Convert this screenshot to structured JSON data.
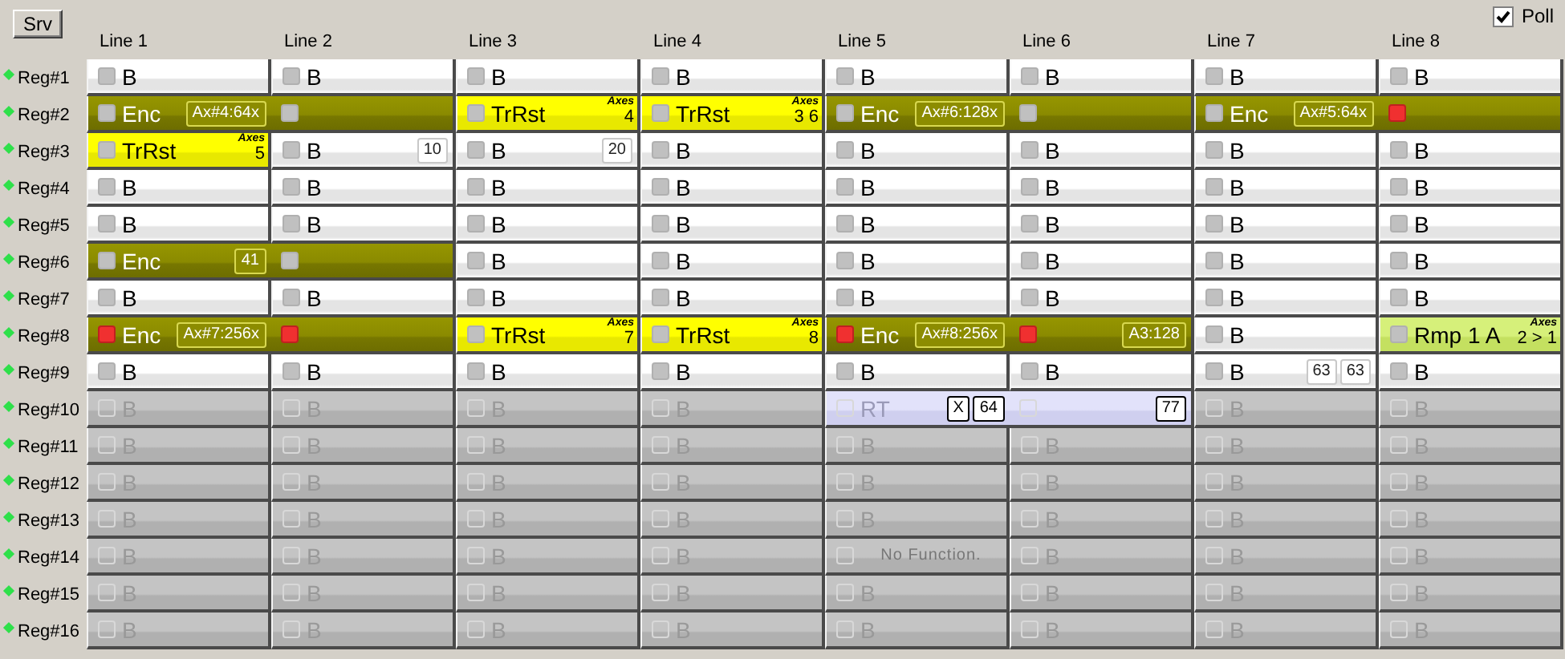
{
  "server_button": "Srv",
  "poll": {
    "label": "Poll",
    "checked": true
  },
  "lines": [
    "Line 1",
    "Line 2",
    "Line 3",
    "Line 4",
    "Line 5",
    "Line 6",
    "Line 7",
    "Line 8"
  ],
  "rows": [
    {
      "label": "Reg#1",
      "disabled": false,
      "cells": [
        {
          "kind": "b",
          "segments": [
            {
              "led_on": false,
              "label": "B"
            }
          ]
        },
        {
          "kind": "b",
          "segments": [
            {
              "led_on": false,
              "label": "B"
            }
          ]
        },
        {
          "kind": "b",
          "segments": [
            {
              "led_on": false,
              "label": "B"
            }
          ]
        },
        {
          "kind": "b",
          "segments": [
            {
              "led_on": false,
              "label": "B"
            }
          ]
        },
        {
          "kind": "b",
          "segments": [
            {
              "led_on": false,
              "label": "B"
            }
          ]
        },
        {
          "kind": "b",
          "segments": [
            {
              "led_on": false,
              "label": "B"
            }
          ]
        },
        {
          "kind": "b",
          "segments": [
            {
              "led_on": false,
              "label": "B"
            }
          ]
        },
        {
          "kind": "b",
          "segments": [
            {
              "led_on": false,
              "label": "B"
            }
          ]
        }
      ]
    },
    {
      "label": "Reg#2",
      "disabled": false,
      "cells": [
        {
          "kind": "enc",
          "segments": [
            {
              "led_on": false,
              "label": "Enc",
              "badges": [
                "Ax#4:64x"
              ]
            },
            {
              "led_on": false
            }
          ]
        },
        {
          "kind": "trrst",
          "segments": [
            {
              "led_on": false,
              "label": "TrRst"
            }
          ],
          "axes": {
            "label": "Axes",
            "value": "4"
          }
        },
        {
          "kind": "trrst",
          "segments": [
            {
              "led_on": false,
              "label": "TrRst"
            }
          ],
          "axes": {
            "label": "Axes",
            "value": "3 6"
          }
        },
        {
          "kind": "enc",
          "segments": [
            {
              "led_on": false,
              "label": "Enc",
              "badges": [
                "Ax#6:128x"
              ]
            },
            {
              "led_on": false
            }
          ]
        },
        {
          "kind": "enc",
          "segments": [
            {
              "led_on": false,
              "label": "Enc",
              "badges": [
                "Ax#5:64x"
              ]
            },
            {
              "led_on": true
            }
          ]
        }
      ]
    },
    {
      "label": "Reg#3",
      "disabled": false,
      "cells": [
        {
          "kind": "trrst",
          "segments": [
            {
              "led_on": false,
              "label": "TrRst"
            }
          ],
          "axes": {
            "label": "Axes",
            "value": "5"
          }
        },
        {
          "kind": "b",
          "segments": [
            {
              "led_on": false,
              "label": "B",
              "badges": [
                "10"
              ]
            }
          ]
        },
        {
          "kind": "b",
          "segments": [
            {
              "led_on": false,
              "label": "B",
              "badges": [
                "20"
              ]
            }
          ]
        },
        {
          "kind": "b",
          "segments": [
            {
              "led_on": false,
              "label": "B"
            }
          ]
        },
        {
          "kind": "b",
          "segments": [
            {
              "led_on": false,
              "label": "B"
            }
          ]
        },
        {
          "kind": "b",
          "segments": [
            {
              "led_on": false,
              "label": "B"
            }
          ]
        },
        {
          "kind": "b",
          "segments": [
            {
              "led_on": false,
              "label": "B"
            }
          ]
        },
        {
          "kind": "b",
          "segments": [
            {
              "led_on": false,
              "label": "B"
            }
          ]
        }
      ]
    },
    {
      "label": "Reg#4",
      "disabled": false,
      "cells": [
        {
          "kind": "b",
          "segments": [
            {
              "led_on": false,
              "label": "B"
            }
          ]
        },
        {
          "kind": "b",
          "segments": [
            {
              "led_on": false,
              "label": "B"
            }
          ]
        },
        {
          "kind": "b",
          "segments": [
            {
              "led_on": false,
              "label": "B"
            }
          ]
        },
        {
          "kind": "b",
          "segments": [
            {
              "led_on": false,
              "label": "B"
            }
          ]
        },
        {
          "kind": "b",
          "segments": [
            {
              "led_on": false,
              "label": "B"
            }
          ]
        },
        {
          "kind": "b",
          "segments": [
            {
              "led_on": false,
              "label": "B"
            }
          ]
        },
        {
          "kind": "b",
          "segments": [
            {
              "led_on": false,
              "label": "B"
            }
          ]
        },
        {
          "kind": "b",
          "segments": [
            {
              "led_on": false,
              "label": "B"
            }
          ]
        }
      ]
    },
    {
      "label": "Reg#5",
      "disabled": false,
      "cells": [
        {
          "kind": "b",
          "segments": [
            {
              "led_on": false,
              "label": "B"
            }
          ]
        },
        {
          "kind": "b",
          "segments": [
            {
              "led_on": false,
              "label": "B"
            }
          ]
        },
        {
          "kind": "b",
          "segments": [
            {
              "led_on": false,
              "label": "B"
            }
          ]
        },
        {
          "kind": "b",
          "segments": [
            {
              "led_on": false,
              "label": "B"
            }
          ]
        },
        {
          "kind": "b",
          "segments": [
            {
              "led_on": false,
              "label": "B"
            }
          ]
        },
        {
          "kind": "b",
          "segments": [
            {
              "led_on": false,
              "label": "B"
            }
          ]
        },
        {
          "kind": "b",
          "segments": [
            {
              "led_on": false,
              "label": "B"
            }
          ]
        },
        {
          "kind": "b",
          "segments": [
            {
              "led_on": false,
              "label": "B"
            }
          ]
        }
      ]
    },
    {
      "label": "Reg#6",
      "disabled": false,
      "cells": [
        {
          "kind": "enc",
          "segments": [
            {
              "led_on": false,
              "label": "Enc",
              "badges": [
                "41"
              ]
            },
            {
              "led_on": false
            }
          ]
        },
        {
          "kind": "b",
          "segments": [
            {
              "led_on": false,
              "label": "B"
            }
          ]
        },
        {
          "kind": "b",
          "segments": [
            {
              "led_on": false,
              "label": "B"
            }
          ]
        },
        {
          "kind": "b",
          "segments": [
            {
              "led_on": false,
              "label": "B"
            }
          ]
        },
        {
          "kind": "b",
          "segments": [
            {
              "led_on": false,
              "label": "B"
            }
          ]
        },
        {
          "kind": "b",
          "segments": [
            {
              "led_on": false,
              "label": "B"
            }
          ]
        },
        {
          "kind": "b",
          "segments": [
            {
              "led_on": false,
              "label": "B"
            }
          ]
        }
      ]
    },
    {
      "label": "Reg#7",
      "disabled": false,
      "cells": [
        {
          "kind": "b",
          "segments": [
            {
              "led_on": false,
              "label": "B"
            }
          ]
        },
        {
          "kind": "b",
          "segments": [
            {
              "led_on": false,
              "label": "B"
            }
          ]
        },
        {
          "kind": "b",
          "segments": [
            {
              "led_on": false,
              "label": "B"
            }
          ]
        },
        {
          "kind": "b",
          "segments": [
            {
              "led_on": false,
              "label": "B"
            }
          ]
        },
        {
          "kind": "b",
          "segments": [
            {
              "led_on": false,
              "label": "B"
            }
          ]
        },
        {
          "kind": "b",
          "segments": [
            {
              "led_on": false,
              "label": "B"
            }
          ]
        },
        {
          "kind": "b",
          "segments": [
            {
              "led_on": false,
              "label": "B"
            }
          ]
        },
        {
          "kind": "b",
          "segments": [
            {
              "led_on": false,
              "label": "B"
            }
          ]
        }
      ]
    },
    {
      "label": "Reg#8",
      "disabled": false,
      "cells": [
        {
          "kind": "enc",
          "segments": [
            {
              "led_on": true,
              "label": "Enc",
              "badges": [
                "Ax#7:256x"
              ]
            },
            {
              "led_on": true
            }
          ]
        },
        {
          "kind": "trrst",
          "segments": [
            {
              "led_on": false,
              "label": "TrRst"
            }
          ],
          "axes": {
            "label": "Axes",
            "value": "7"
          }
        },
        {
          "kind": "trrst",
          "segments": [
            {
              "led_on": false,
              "label": "TrRst"
            }
          ],
          "axes": {
            "label": "Axes",
            "value": "8"
          }
        },
        {
          "kind": "enc",
          "segments": [
            {
              "led_on": true,
              "label": "Enc",
              "badges": [
                "Ax#8:256x"
              ]
            },
            {
              "led_on": true,
              "badges": [
                "A3:128"
              ]
            }
          ]
        },
        {
          "kind": "b",
          "segments": [
            {
              "led_on": false,
              "label": "B"
            }
          ]
        },
        {
          "kind": "rmp",
          "segments": [
            {
              "led_on": false,
              "label": "Rmp 1 A"
            }
          ],
          "axes": {
            "label": "Axes",
            "value": "2 > 1"
          }
        }
      ]
    },
    {
      "label": "Reg#9",
      "disabled": false,
      "cells": [
        {
          "kind": "b",
          "segments": [
            {
              "led_on": false,
              "label": "B"
            }
          ]
        },
        {
          "kind": "b",
          "segments": [
            {
              "led_on": false,
              "label": "B"
            }
          ]
        },
        {
          "kind": "b",
          "segments": [
            {
              "led_on": false,
              "label": "B"
            }
          ]
        },
        {
          "kind": "b",
          "segments": [
            {
              "led_on": false,
              "label": "B"
            }
          ]
        },
        {
          "kind": "b",
          "segments": [
            {
              "led_on": false,
              "label": "B"
            }
          ]
        },
        {
          "kind": "b",
          "segments": [
            {
              "led_on": false,
              "label": "B"
            }
          ]
        },
        {
          "kind": "b",
          "segments": [
            {
              "led_on": false,
              "label": "B",
              "badges": [
                "63",
                "63"
              ]
            }
          ]
        },
        {
          "kind": "b",
          "segments": [
            {
              "led_on": false,
              "label": "B"
            }
          ]
        }
      ]
    },
    {
      "label": "Reg#10",
      "disabled": true,
      "cells": [
        {
          "kind": "b",
          "segments": [
            {
              "led_on": false,
              "label": "B"
            }
          ]
        },
        {
          "kind": "b",
          "segments": [
            {
              "led_on": false,
              "label": "B"
            }
          ]
        },
        {
          "kind": "b",
          "segments": [
            {
              "led_on": false,
              "label": "B"
            }
          ]
        },
        {
          "kind": "b",
          "segments": [
            {
              "led_on": false,
              "label": "B"
            }
          ]
        },
        {
          "kind": "rt",
          "segments": [
            {
              "led_on": false,
              "label": "RT",
              "badges": [
                "X",
                "64"
              ]
            },
            {
              "led_on": false,
              "badges": [
                "77"
              ]
            }
          ]
        },
        {
          "kind": "b",
          "segments": [
            {
              "led_on": false,
              "label": "B"
            }
          ]
        },
        {
          "kind": "b",
          "segments": [
            {
              "led_on": false,
              "label": "B"
            }
          ]
        }
      ]
    },
    {
      "label": "Reg#11",
      "disabled": true,
      "cells": [
        {
          "kind": "b",
          "segments": [
            {
              "led_on": false,
              "label": "B"
            }
          ]
        },
        {
          "kind": "b",
          "segments": [
            {
              "led_on": false,
              "label": "B"
            }
          ]
        },
        {
          "kind": "b",
          "segments": [
            {
              "led_on": false,
              "label": "B"
            }
          ]
        },
        {
          "kind": "b",
          "segments": [
            {
              "led_on": false,
              "label": "B"
            }
          ]
        },
        {
          "kind": "b",
          "segments": [
            {
              "led_on": false,
              "label": "B"
            }
          ]
        },
        {
          "kind": "b",
          "segments": [
            {
              "led_on": false,
              "label": "B"
            }
          ]
        },
        {
          "kind": "b",
          "segments": [
            {
              "led_on": false,
              "label": "B"
            }
          ]
        },
        {
          "kind": "b",
          "segments": [
            {
              "led_on": false,
              "label": "B"
            }
          ]
        }
      ]
    },
    {
      "label": "Reg#12",
      "disabled": true,
      "cells": [
        {
          "kind": "b",
          "segments": [
            {
              "led_on": false,
              "label": "B"
            }
          ]
        },
        {
          "kind": "b",
          "segments": [
            {
              "led_on": false,
              "label": "B"
            }
          ]
        },
        {
          "kind": "b",
          "segments": [
            {
              "led_on": false,
              "label": "B"
            }
          ]
        },
        {
          "kind": "b",
          "segments": [
            {
              "led_on": false,
              "label": "B"
            }
          ]
        },
        {
          "kind": "b",
          "segments": [
            {
              "led_on": false,
              "label": "B"
            }
          ]
        },
        {
          "kind": "b",
          "segments": [
            {
              "led_on": false,
              "label": "B"
            }
          ]
        },
        {
          "kind": "b",
          "segments": [
            {
              "led_on": false,
              "label": "B"
            }
          ]
        },
        {
          "kind": "b",
          "segments": [
            {
              "led_on": false,
              "label": "B"
            }
          ]
        }
      ]
    },
    {
      "label": "Reg#13",
      "disabled": true,
      "cells": [
        {
          "kind": "b",
          "segments": [
            {
              "led_on": false,
              "label": "B"
            }
          ]
        },
        {
          "kind": "b",
          "segments": [
            {
              "led_on": false,
              "label": "B"
            }
          ]
        },
        {
          "kind": "b",
          "segments": [
            {
              "led_on": false,
              "label": "B"
            }
          ]
        },
        {
          "kind": "b",
          "segments": [
            {
              "led_on": false,
              "label": "B"
            }
          ]
        },
        {
          "kind": "b",
          "segments": [
            {
              "led_on": false,
              "label": "B"
            }
          ]
        },
        {
          "kind": "b",
          "segments": [
            {
              "led_on": false,
              "label": "B"
            }
          ]
        },
        {
          "kind": "b",
          "segments": [
            {
              "led_on": false,
              "label": "B"
            }
          ]
        },
        {
          "kind": "b",
          "segments": [
            {
              "led_on": false,
              "label": "B"
            }
          ]
        }
      ]
    },
    {
      "label": "Reg#14",
      "disabled": true,
      "cells": [
        {
          "kind": "b",
          "segments": [
            {
              "led_on": false,
              "label": "B"
            }
          ]
        },
        {
          "kind": "b",
          "segments": [
            {
              "led_on": false,
              "label": "B"
            }
          ]
        },
        {
          "kind": "b",
          "segments": [
            {
              "led_on": false,
              "label": "B"
            }
          ]
        },
        {
          "kind": "b",
          "segments": [
            {
              "led_on": false,
              "label": "B"
            }
          ]
        },
        {
          "kind": "nofunc",
          "segments": [
            {
              "led_on": false,
              "label": "No Function."
            }
          ]
        },
        {
          "kind": "b",
          "segments": [
            {
              "led_on": false,
              "label": "B"
            }
          ]
        },
        {
          "kind": "b",
          "segments": [
            {
              "led_on": false,
              "label": "B"
            }
          ]
        },
        {
          "kind": "b",
          "segments": [
            {
              "led_on": false,
              "label": "B"
            }
          ]
        }
      ]
    },
    {
      "label": "Reg#15",
      "disabled": true,
      "cells": [
        {
          "kind": "b",
          "segments": [
            {
              "led_on": false,
              "label": "B"
            }
          ]
        },
        {
          "kind": "b",
          "segments": [
            {
              "led_on": false,
              "label": "B"
            }
          ]
        },
        {
          "kind": "b",
          "segments": [
            {
              "led_on": false,
              "label": "B"
            }
          ]
        },
        {
          "kind": "b",
          "segments": [
            {
              "led_on": false,
              "label": "B"
            }
          ]
        },
        {
          "kind": "b",
          "segments": [
            {
              "led_on": false,
              "label": "B"
            }
          ]
        },
        {
          "kind": "b",
          "segments": [
            {
              "led_on": false,
              "label": "B"
            }
          ]
        },
        {
          "kind": "b",
          "segments": [
            {
              "led_on": false,
              "label": "B"
            }
          ]
        },
        {
          "kind": "b",
          "segments": [
            {
              "led_on": false,
              "label": "B"
            }
          ]
        }
      ]
    },
    {
      "label": "Reg#16",
      "disabled": true,
      "cells": [
        {
          "kind": "b",
          "segments": [
            {
              "led_on": false,
              "label": "B"
            }
          ]
        },
        {
          "kind": "b",
          "segments": [
            {
              "led_on": false,
              "label": "B"
            }
          ]
        },
        {
          "kind": "b",
          "segments": [
            {
              "led_on": false,
              "label": "B"
            }
          ]
        },
        {
          "kind": "b",
          "segments": [
            {
              "led_on": false,
              "label": "B"
            }
          ]
        },
        {
          "kind": "b",
          "segments": [
            {
              "led_on": false,
              "label": "B"
            }
          ]
        },
        {
          "kind": "b",
          "segments": [
            {
              "led_on": false,
              "label": "B"
            }
          ]
        },
        {
          "kind": "b",
          "segments": [
            {
              "led_on": false,
              "label": "B"
            }
          ]
        },
        {
          "kind": "b",
          "segments": [
            {
              "led_on": false,
              "label": "B"
            }
          ]
        }
      ]
    }
  ]
}
